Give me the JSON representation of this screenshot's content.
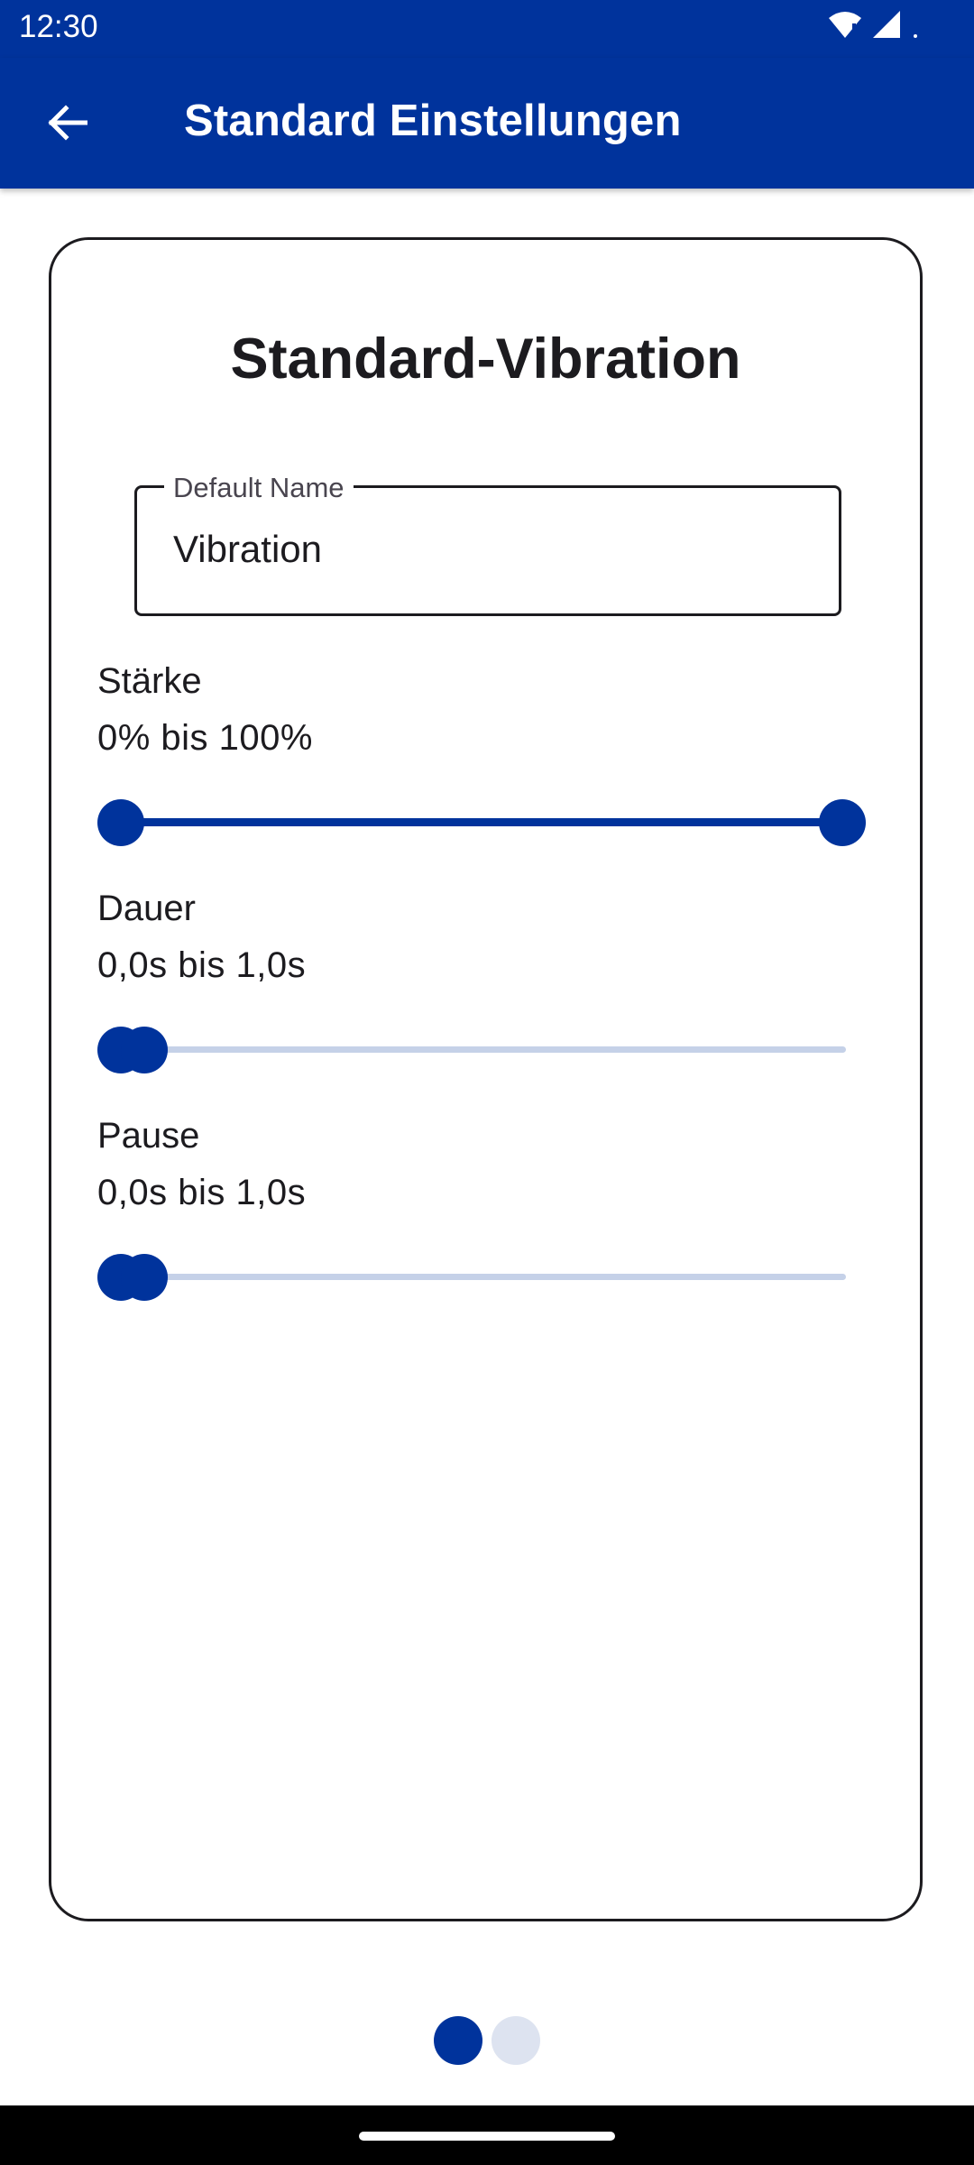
{
  "status_bar": {
    "time": "12:30",
    "icons": [
      "wifi-icon",
      "signal-icon",
      "battery-dot-icon"
    ]
  },
  "app_bar": {
    "back_icon": "arrow-left-icon",
    "title": "Standard Einstellungen"
  },
  "card": {
    "title": "Standard-Vibration",
    "name_field": {
      "label": "Default Name",
      "value": "Vibration"
    },
    "settings": [
      {
        "label": "Stärke",
        "range_text": "0% bis 100%",
        "min_fraction": 0.0,
        "max_fraction": 1.0
      },
      {
        "label": "Dauer",
        "range_text": "0,0s bis 1,0s",
        "min_fraction": 0.0,
        "max_fraction": 0.0
      },
      {
        "label": "Pause",
        "range_text": "0,0s bis 1,0s",
        "min_fraction": 0.0,
        "max_fraction": 0.0
      }
    ]
  },
  "page_indicator": {
    "total": 2,
    "active": 1
  },
  "colors": {
    "primary": "#00339c",
    "track_inactive": "#c5d1e8",
    "dot_inactive": "#dde3f0"
  }
}
